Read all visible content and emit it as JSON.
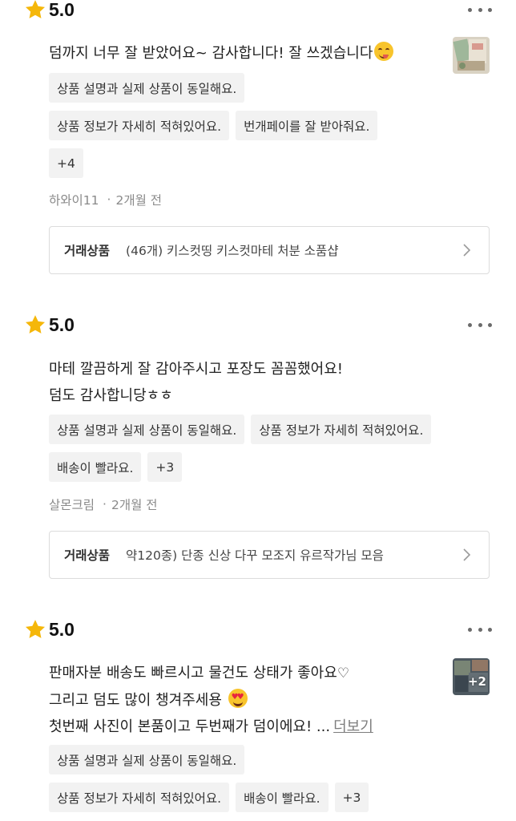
{
  "reviews": [
    {
      "rating": "5.0",
      "text_lines": [
        "덤까지 너무 잘 받았어요~ 감사합니다! 잘 쓰겠습니다"
      ],
      "emoji": "face-savoring-food-emoji",
      "chips": [
        [
          "상품 설명과 실제 상품이 동일해요."
        ],
        [
          "상품 정보가 자세히 적혀있어요.",
          "번개페이를 잘 받아줘요."
        ],
        [
          "+4"
        ]
      ],
      "author": "하와이11",
      "time": "2개월 전",
      "product_label": "거래상품",
      "product_name": "(46개) 키스컷띵 키스컷마테 처분 소품샵",
      "has_thumbnail": true
    },
    {
      "rating": "5.0",
      "text_lines": [
        "마테 깔끔하게 잘 감아주시고 포장도 꼼꼼했어요!",
        "덤도 감사합니당ㅎㅎ"
      ],
      "chips": [
        [
          "상품 설명과 실제 상품이 동일해요.",
          "상품 정보가 자세히 적혀있어요."
        ],
        [
          "배송이 빨라요.",
          "+3"
        ]
      ],
      "author": "살몬크림",
      "time": "2개월 전",
      "product_label": "거래상품",
      "product_name": "약120종) 단종 신상 다꾸 모조지 유르작가님 모음",
      "has_thumbnail": false
    },
    {
      "rating": "5.0",
      "text_lines": [
        "판매자분 배송도 빠르시고 물건도 상태가 좋아요",
        "그리고 덤도 많이 챙겨주세용",
        "첫번째 사진이 본품이고 두번째가 덤이에요! ..."
      ],
      "more_label": "더보기",
      "chips": [
        [
          "상품 설명과 실제 상품이 동일해요."
        ],
        [
          "상품 정보가 자세히 적혀있어요.",
          "배송이 빨라요.",
          "+3"
        ]
      ],
      "thumbnail_count": "+2",
      "has_thumbnail": true
    }
  ],
  "colors": {
    "star": "#F5B70A",
    "chip_bg": "#F2F2F2",
    "meta_text": "#8A8A8A",
    "card_border": "#DCDCDC"
  }
}
